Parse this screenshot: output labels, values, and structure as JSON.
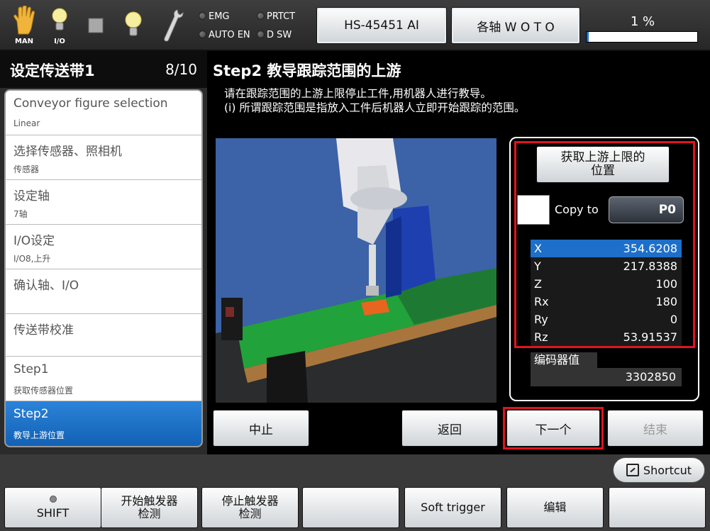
{
  "topbar": {
    "man_label": "MAN",
    "io_label": "I/O",
    "lamps": {
      "emg": "EMG",
      "prtct": "PRTCT",
      "auto_en": "AUTO EN",
      "dsw": "D SW"
    },
    "robot_button": "HS-45451 AI",
    "axis_button": "各轴 W O T O",
    "progress_text": "1 %",
    "progress_value": 0.01
  },
  "left": {
    "title": "设定传送带1",
    "page": "8/10",
    "steps": [
      {
        "title": "Conveyor figure selection",
        "sub": "Linear"
      },
      {
        "title": "选择传感器、照相机",
        "sub": "传感器"
      },
      {
        "title": "设定轴",
        "sub": "7轴"
      },
      {
        "title": "I/O设定",
        "sub": "I/O8,上升"
      },
      {
        "title": "确认轴、I/O",
        "sub": ""
      },
      {
        "title": "传送带校准",
        "sub": ""
      },
      {
        "title": "Step1",
        "sub": "获取传感器位置"
      },
      {
        "title": "Step2",
        "sub": "教导上游位置"
      }
    ]
  },
  "main": {
    "step_title": "Step2 教导跟踪范围的上游",
    "instructions_line1": "请在跟踪范围的上游上限停止工件,用机器人进行教导。",
    "instructions_line2": "(i) 所谓跟踪范围是指放入工件后机器人立即开始跟踪的范围。",
    "get_upper_line1": "获取上游上限的",
    "get_upper_line2": "位置",
    "copy_label": "Copy to",
    "copy_value": "P0",
    "coords": [
      {
        "k": "X",
        "v": "354.6208"
      },
      {
        "k": "Y",
        "v": "217.8388"
      },
      {
        "k": "Z",
        "v": "100"
      },
      {
        "k": "Rx",
        "v": "180"
      },
      {
        "k": "Ry",
        "v": "0"
      },
      {
        "k": "Rz",
        "v": "53.91537"
      }
    ],
    "encoder_label": "编码器值",
    "encoder_value": "3302850",
    "buttons": {
      "abort": "中止",
      "back": "返回",
      "next": "下一个",
      "finish": "结束"
    }
  },
  "footer": {
    "shortcut": "Shortcut",
    "keys": [
      "SHIFT",
      "开始触发器\n检测",
      "停止触发器\n检测",
      "",
      "Soft trigger",
      "编辑",
      ""
    ]
  },
  "colors": {
    "active_step": "#1d6fc9",
    "highlight_red": "#e0141e",
    "selected_row": "#1d6fc9"
  }
}
